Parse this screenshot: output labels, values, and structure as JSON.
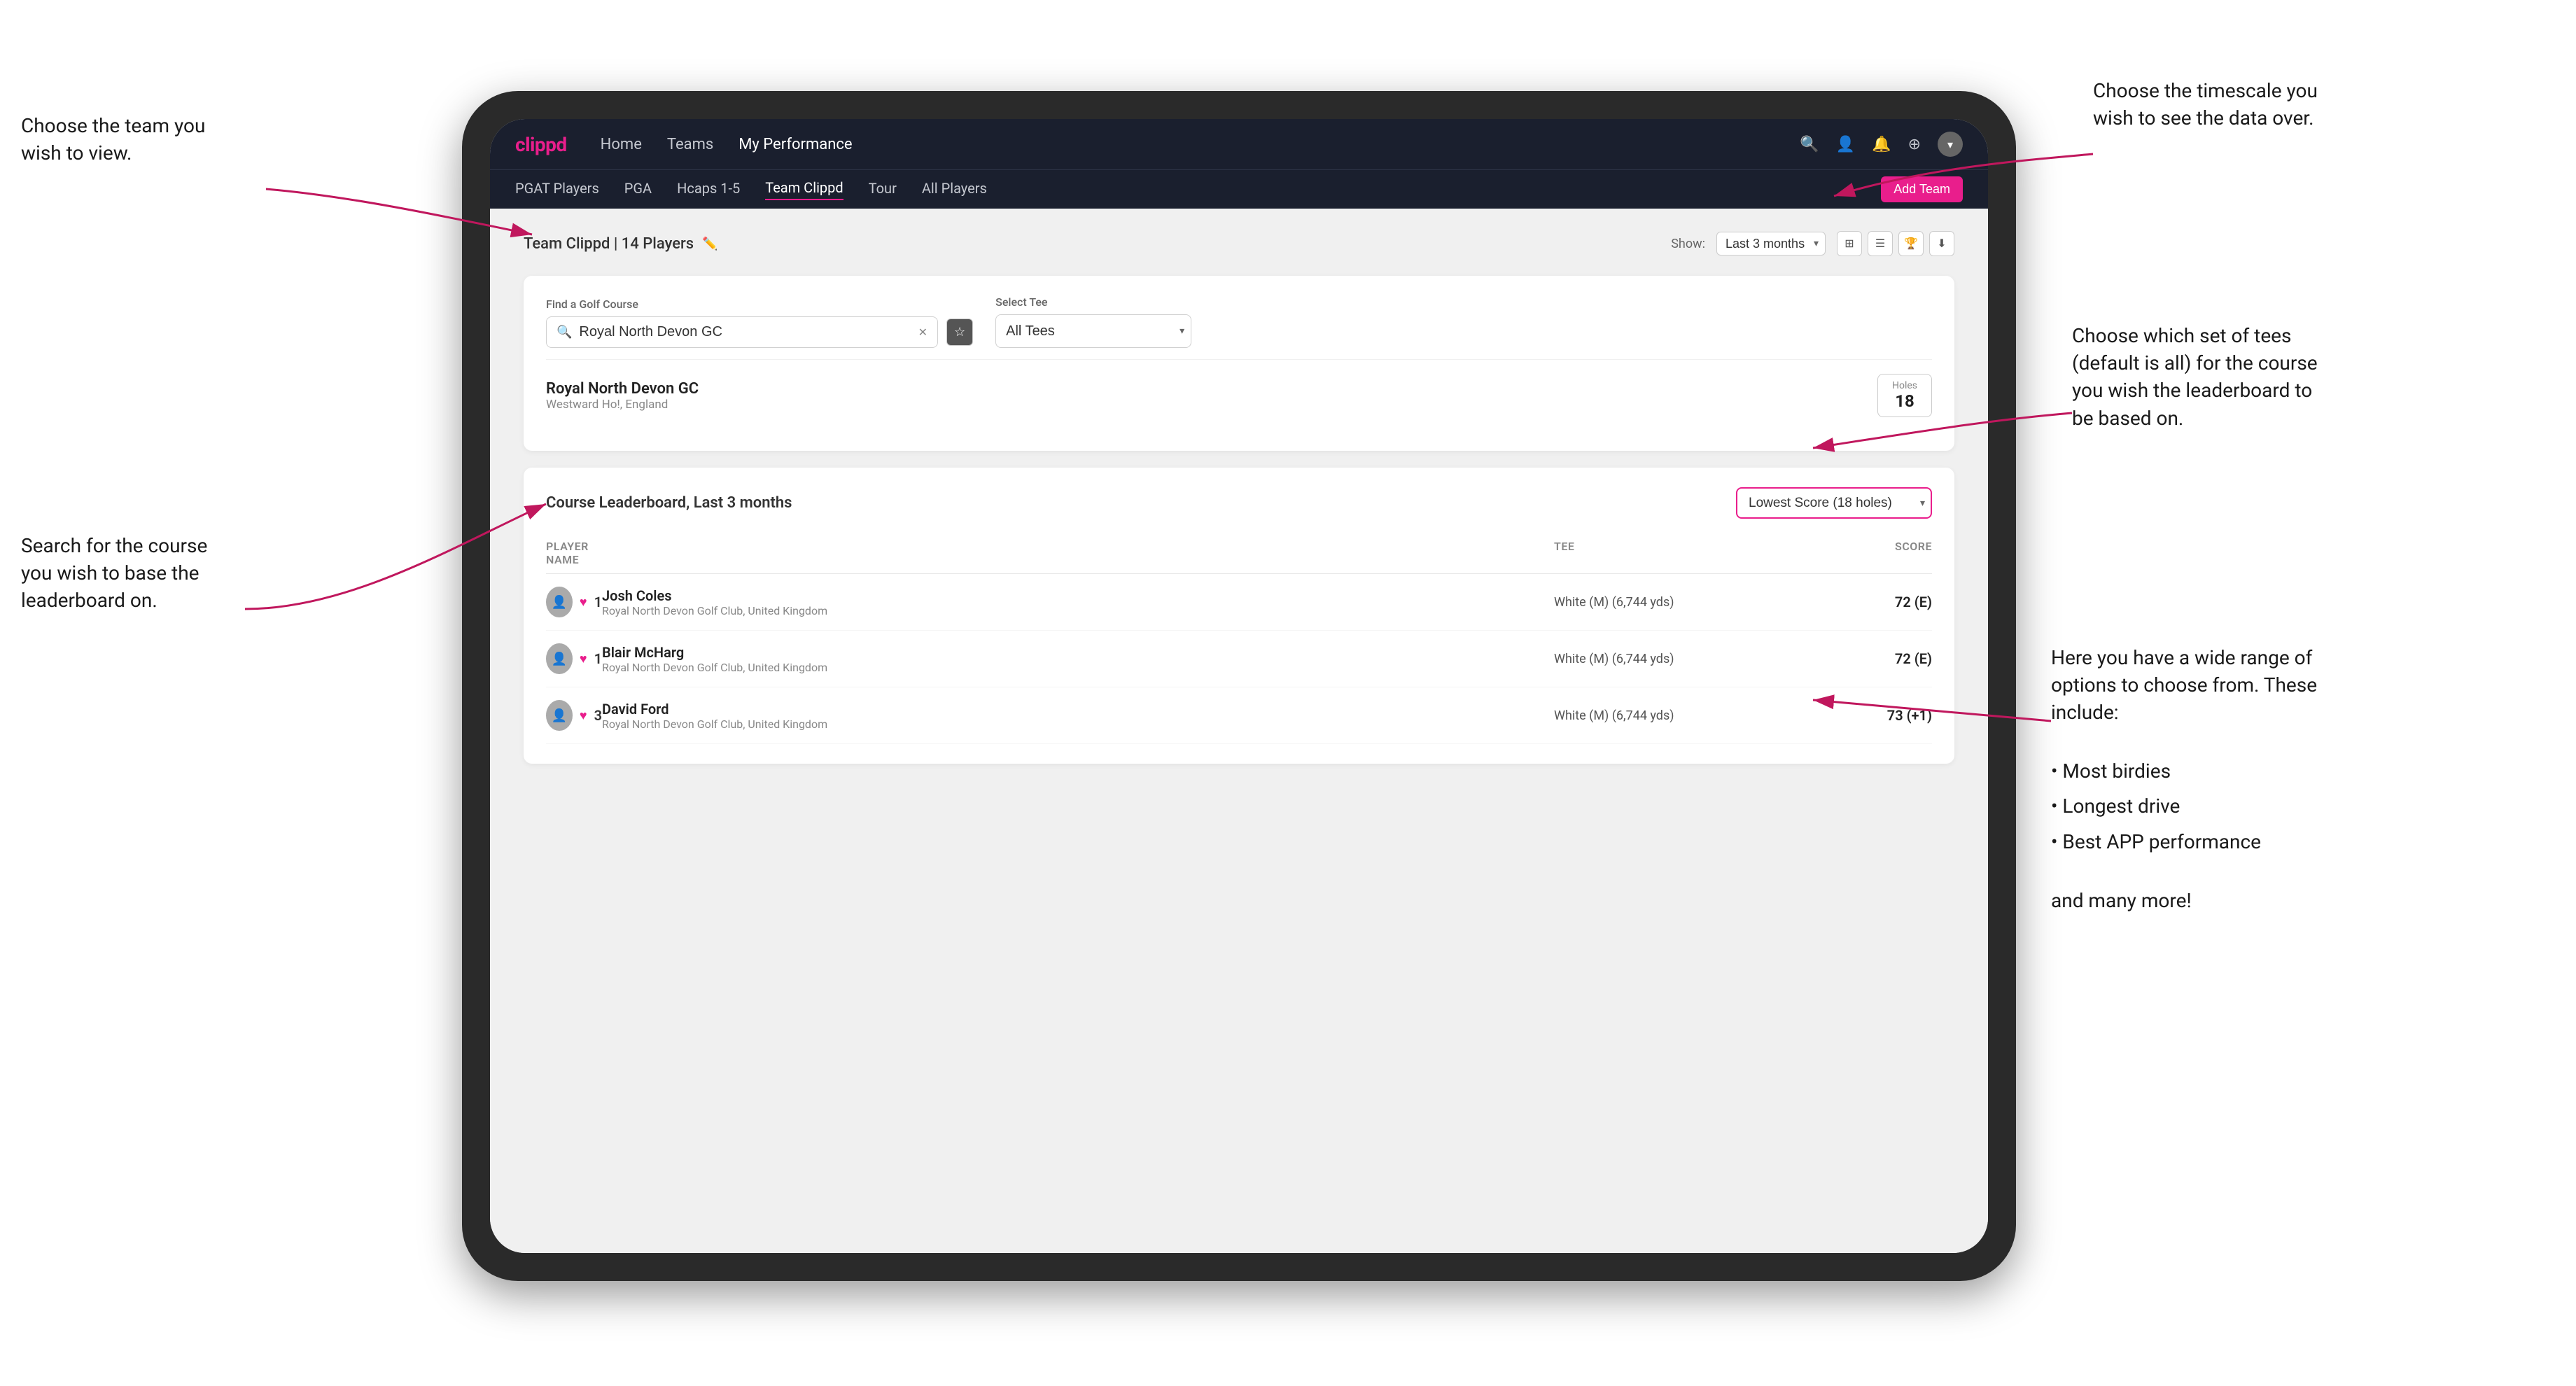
{
  "annotations": {
    "top_left_title": "Choose the team you\nwish to view.",
    "bottom_left_title": "Search for the course\nyou wish to base the\nleaderboard on.",
    "top_right_title": "Choose the timescale you\nwish to see the data over.",
    "middle_right_title": "Choose which set of tees\n(default is all) for the course\nyou wish the leaderboard to\nbe based on.",
    "bottom_right_title": "Here you have a wide range\nof options to choose from.\nThese include:",
    "bullet_items": [
      "Most birdies",
      "Longest drive",
      "Best APP performance"
    ],
    "and_more": "and many more!"
  },
  "nav": {
    "logo": "clippd",
    "links": [
      "Home",
      "Teams",
      "My Performance"
    ],
    "active_link": "My Performance",
    "icons": [
      "search",
      "person",
      "bell",
      "settings",
      "avatar"
    ]
  },
  "sub_nav": {
    "links": [
      "PGAT Players",
      "PGA",
      "Hcaps 1-5",
      "Team Clippd",
      "Tour",
      "All Players"
    ],
    "active_link": "Team Clippd",
    "add_team_label": "Add Team"
  },
  "team_header": {
    "title": "Team Clippd",
    "player_count": "14 Players",
    "show_label": "Show:",
    "time_period": "Last 3 months"
  },
  "course_search": {
    "find_label": "Find a Golf Course",
    "search_value": "Royal North Devon GC",
    "select_tee_label": "Select Tee",
    "tee_value": "All Tees",
    "result_name": "Royal North Devon GC",
    "result_location": "Westward Ho!, England",
    "holes_label": "Holes",
    "holes_value": "18"
  },
  "leaderboard": {
    "title": "Course Leaderboard,",
    "subtitle": "Last 3 months",
    "score_option": "Lowest Score (18 holes)",
    "columns": {
      "player": "PLAYER NAME",
      "tee": "TEE",
      "score": "SCORE"
    },
    "players": [
      {
        "rank": "1",
        "name": "Josh Coles",
        "club": "Royal North Devon Golf Club, United Kingdom",
        "tee": "White (M) (6,744 yds)",
        "score": "72 (E)",
        "has_heart": true
      },
      {
        "rank": "1",
        "name": "Blair McHarg",
        "club": "Royal North Devon Golf Club, United Kingdom",
        "tee": "White (M) (6,744 yds)",
        "score": "72 (E)",
        "has_heart": true
      },
      {
        "rank": "3",
        "name": "David Ford",
        "club": "Royal North Devon Golf Club, United Kingdom",
        "tee": "White (M) (6,744 yds)",
        "score": "73 (+1)",
        "has_heart": true
      }
    ]
  },
  "colors": {
    "brand_pink": "#e91e8c",
    "nav_bg": "#1a1f2e",
    "body_bg": "#f0f0f0"
  }
}
